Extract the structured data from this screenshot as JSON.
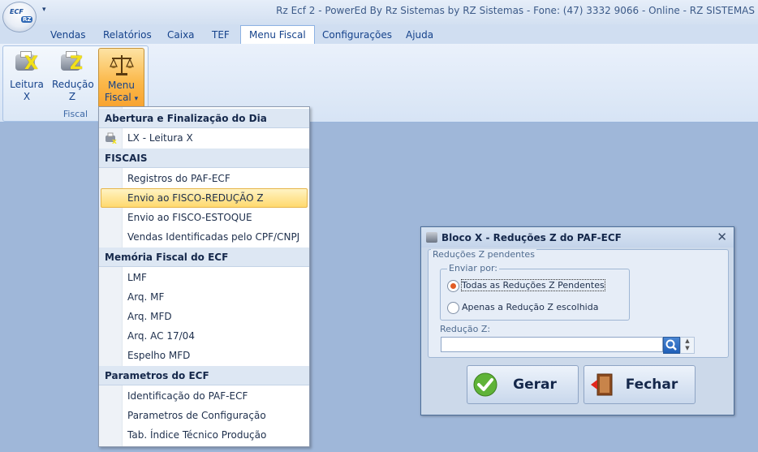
{
  "app": {
    "title": "Rz Ecf 2 - PowerEd By Rz Sistemas by RZ Sistemas - Fone: (47) 3332 9066 - Online - RZ SISTEMAS",
    "orb_text": "ECF",
    "orb_badge": "RZ",
    "qat_symbol": "▾"
  },
  "tabs": [
    {
      "label": "Vendas"
    },
    {
      "label": "Relatórios"
    },
    {
      "label": "Caixa"
    },
    {
      "label": "TEF"
    },
    {
      "label": "Menu Fiscal",
      "active": true
    },
    {
      "label": "Configurações"
    },
    {
      "label": "Ajuda"
    }
  ],
  "ribbon": {
    "group_label": "Fiscal",
    "buttons": [
      {
        "line1": "Leitura",
        "line2": "X",
        "icon": "printer-x-icon",
        "letter": "X"
      },
      {
        "line1": "Redução",
        "line2": "Z",
        "icon": "printer-z-icon",
        "letter": "Z"
      },
      {
        "line1": "Menu",
        "line2": "Fiscal",
        "icon": "scales-icon",
        "dropdown": "▾"
      }
    ]
  },
  "menu": {
    "headers": [
      "Abertura e  Finalização do Dia",
      "FISCAIS",
      "Memória Fiscal do ECF",
      "Parametros do ECF"
    ],
    "items": [
      "LX - Leitura X",
      "Registros do PAF-ECF",
      "Envio ao FISCO-REDUÇÃO Z",
      "Envio ao FISCO-ESTOQUE",
      "Vendas Identificadas pelo CPF/CNPJ",
      "LMF",
      "Arq. MF",
      "Arq. MFD",
      "Arq. AC 17/04",
      "Espelho MFD",
      "Identificação do PAF-ECF",
      "Parametros de Configuração",
      "Tab. Índice Técnico Produção"
    ],
    "highlighted_item": "Envio ao FISCO-REDUÇÃO Z"
  },
  "dialog": {
    "title": "Bloco X - Reduções Z do PAF-ECF",
    "close_symbol": "✕",
    "group_legend": "Reduções Z pendentes",
    "send_legend": "Enviar por:",
    "option_all": "Todas as Reduções Z Pendentes",
    "option_chosen": "Apenas a Redução Z escolhida",
    "selected_option": "Todas as Reduções Z Pendentes",
    "field_label": "Redução Z:",
    "field_value": "",
    "gerar_label": "Gerar",
    "fechar_label": "Fechar"
  }
}
